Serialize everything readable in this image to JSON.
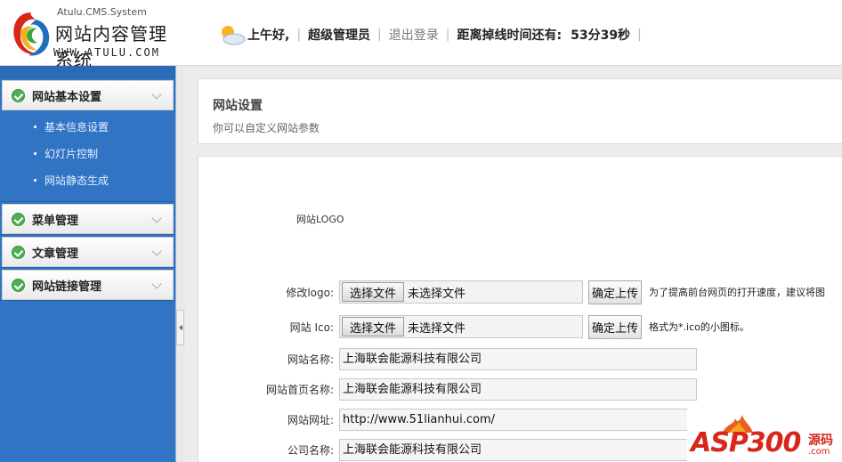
{
  "header": {
    "logo_system": "Atulu.CMS.System",
    "logo_name": "网站内容管理系统",
    "logo_url": "WWW.ATULU.COM",
    "greeting": "上午好,",
    "user": "超级管理员",
    "logout": "退出登录",
    "remain_label": "距离掉线时间还有:",
    "remain_value": "53分39秒"
  },
  "sidebar": {
    "groups": [
      {
        "label": "网站基本设置",
        "items": [
          "基本信息设置",
          "幻灯片控制",
          "网站静态生成"
        ]
      },
      {
        "label": "菜单管理"
      },
      {
        "label": "文章管理"
      },
      {
        "label": "网站链接管理"
      }
    ]
  },
  "page": {
    "title": "网站设置",
    "desc": "你可以自定义网站参数"
  },
  "form": {
    "logo_label": "网站LOGO",
    "edit_logo_label": "修改logo:",
    "ico_label": "网站 Ico:",
    "choose_file": "选择文件",
    "no_file": "未选择文件",
    "upload": "确定上传",
    "logo_hint": "为了提高前台网页的打开速度，建议将图",
    "ico_hint": "格式为*.ico的小图标。",
    "site_name_label": "网站名称:",
    "site_name": "上海联会能源科技有限公司",
    "home_name_label": "网站首页名称:",
    "home_name": "上海联会能源科技有限公司",
    "site_url_label": "网站网址:",
    "site_url": "http://www.51lianhui.com/",
    "company_label": "公司名称:",
    "company": "上海联会能源科技有限公司"
  },
  "watermark": {
    "text": "ASP300",
    "cn": "源码",
    "domain": ".com"
  },
  "colors": {
    "sidebar": "#3174c4",
    "check": "#4caf50",
    "watermark": "#d8261b"
  }
}
